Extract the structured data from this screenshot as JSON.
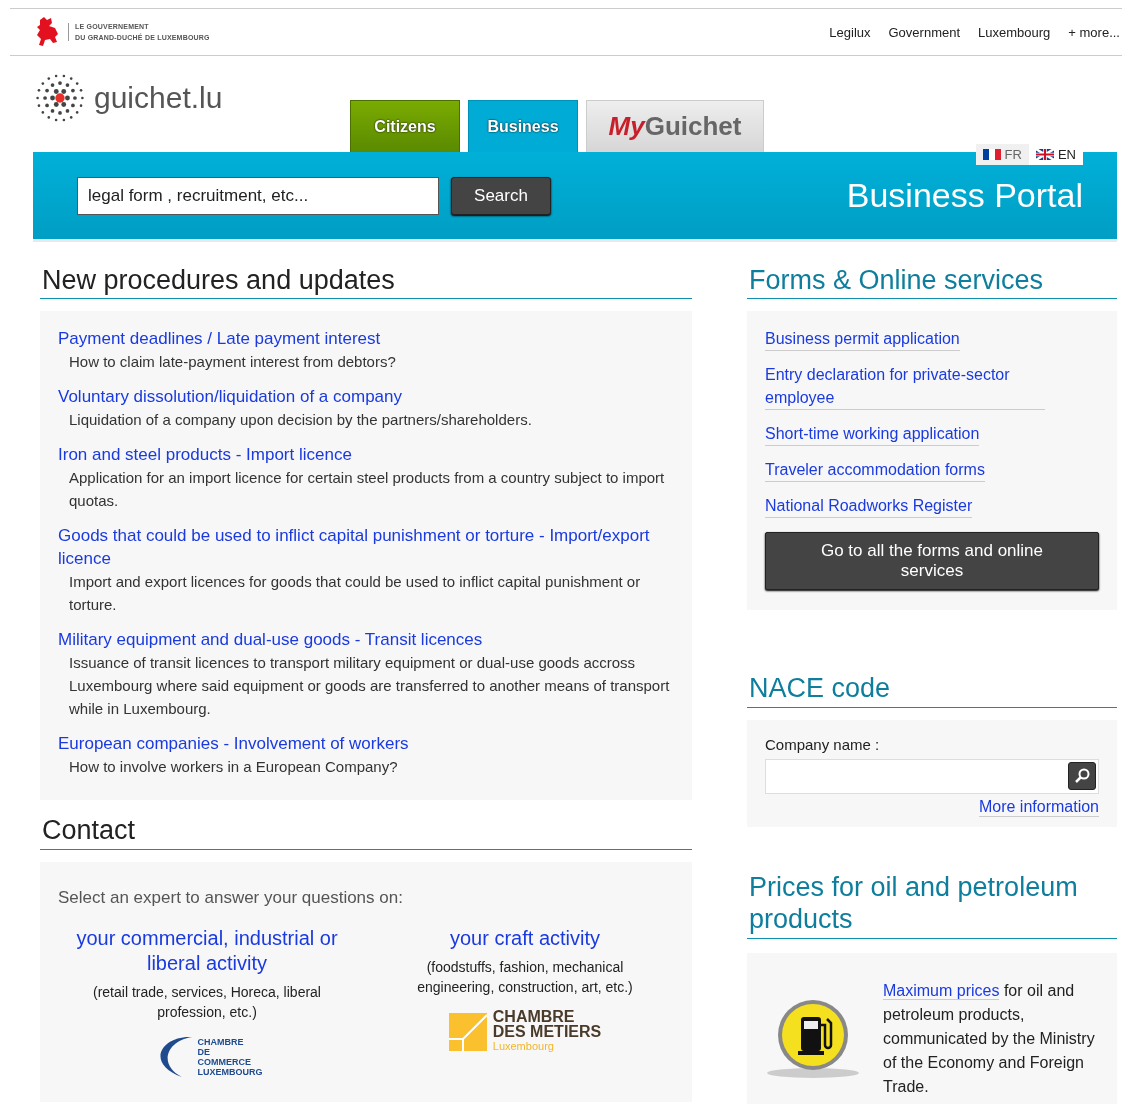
{
  "gov_header": {
    "line_1": "LE GOUVERNEMENT",
    "line_2": "DU GRAND-DUCHÉ DE LUXEMBOURG",
    "links": [
      "Legilux",
      "Government",
      "Luxembourg",
      "+ more..."
    ]
  },
  "logo": {
    "text": "guichet.lu"
  },
  "tabs": [
    {
      "kind": "citizens",
      "label": "Citizens",
      "selected": false
    },
    {
      "kind": "business",
      "label": "Business",
      "selected": true
    },
    {
      "kind": "myguichet",
      "label_1": "My",
      "label_2": "Guichet",
      "selected": false
    }
  ],
  "languages": [
    {
      "label": "FR",
      "kind": "fr",
      "selected": false
    },
    {
      "label": "EN",
      "kind": "uk",
      "selected": true
    }
  ],
  "search": {
    "value": "legal form , recruitment, etc...",
    "button": "Search"
  },
  "portal_title": "Business Portal",
  "procedures": {
    "heading": "New procedures and updates",
    "items": [
      {
        "title": "Payment deadlines / Late payment interest",
        "description": "How to claim late-payment interest from debtors?"
      },
      {
        "title": "Voluntary dissolution/liquidation of a company",
        "description": "Liquidation of a company upon decision by the partners/shareholders."
      },
      {
        "title": "Iron and steel products - Import licence",
        "description": "Application for an import licence for certain steel products from a country subject to import quotas."
      },
      {
        "title": "Goods that could be used to inflict capital punishment or torture - Import/export licence",
        "description": "Import and export licences for goods that could be used to inflict capital punishment or torture."
      },
      {
        "title": "Military equipment and dual-use goods - Transit licences",
        "description": "Issuance of transit licences to transport military equipment or dual-use goods accross Luxembourg where said equipment or goods are transferred to another means of transport while in Luxembourg."
      },
      {
        "title": "European companies - Involvement of workers",
        "description": "How to involve workers in a European Company?"
      }
    ]
  },
  "contact": {
    "heading": "Contact",
    "intro": "Select an expert to answer your questions on:",
    "experts": [
      {
        "kind": "commerce",
        "title": "your commercial, industrial or liberal activity",
        "description": "(retail trade, services, Horeca, liberal profession, etc.)",
        "logo_lines": [
          "CHAMBRE",
          "DE",
          "COMMERCE",
          "LUXEMBOURG"
        ]
      },
      {
        "kind": "metiers",
        "title": "your craft activity",
        "description": "(foodstuffs, fashion, mechanical engineering, construction, art, etc.)",
        "logo_lines": [
          "CHAMBRE",
          "DES METIERS",
          "Luxembourg"
        ]
      }
    ]
  },
  "forms": {
    "heading": "Forms & Online services",
    "links": [
      "Business permit application",
      "Entry declaration for private-sector employee",
      "Short-time working application",
      "Traveler accommodation forms",
      "National Roadworks Register"
    ],
    "button": "Go to all the forms and online services"
  },
  "nace": {
    "heading": "NACE code",
    "label": "Company name :",
    "more_link": "More information"
  },
  "prices": {
    "heading": "Prices for oil and petroleum products",
    "link": "Maximum prices",
    "text": " for oil and petroleum products, communicated by the Ministry of the Economy and Foreign Trade."
  }
}
